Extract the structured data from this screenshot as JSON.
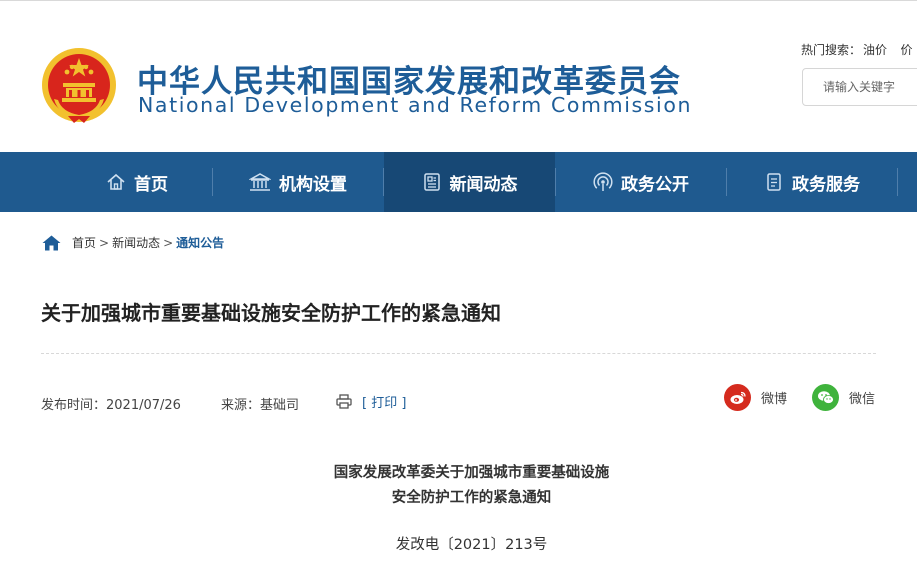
{
  "header": {
    "title_cn": "中华人民共和国国家发展和改革委员会",
    "title_en": "National Development and Reform Commission",
    "hot_search_label": "热门搜索：",
    "hot_search_keywords": [
      "油价",
      "价"
    ],
    "search_placeholder": "请输入关键字"
  },
  "nav": {
    "items": [
      {
        "label": "首页",
        "icon": "home-icon"
      },
      {
        "label": "机构设置",
        "icon": "institution-icon"
      },
      {
        "label": "新闻动态",
        "icon": "news-icon",
        "active": true
      },
      {
        "label": "政务公开",
        "icon": "broadcast-icon"
      },
      {
        "label": "政务服务",
        "icon": "document-icon"
      }
    ]
  },
  "breadcrumb": {
    "items": [
      "首页",
      "新闻动态",
      "通知公告"
    ],
    "separator": ">"
  },
  "article": {
    "title": "关于加强城市重要基础设施安全防护工作的紧急通知",
    "publish_time": "发布时间：2021/07/26",
    "source": "来源：基础司",
    "print_label": "[ 打印 ]",
    "share": {
      "weibo_label": "微博",
      "wechat_label": "微信"
    },
    "doc_heading_line1": "国家发展改革委关于加强城市重要基础设施",
    "doc_heading_line2": "安全防护工作的紧急通知",
    "doc_number": "发改电〔2021〕213号"
  },
  "colors": {
    "brand_blue": "#1e5d98",
    "nav_bg": "#1f5a8f",
    "nav_active_bg": "#174875",
    "weibo_red": "#d52b1e",
    "wechat_green": "#3fb33c",
    "emblem_red": "#d8251c",
    "emblem_gold": "#f2c12e"
  }
}
